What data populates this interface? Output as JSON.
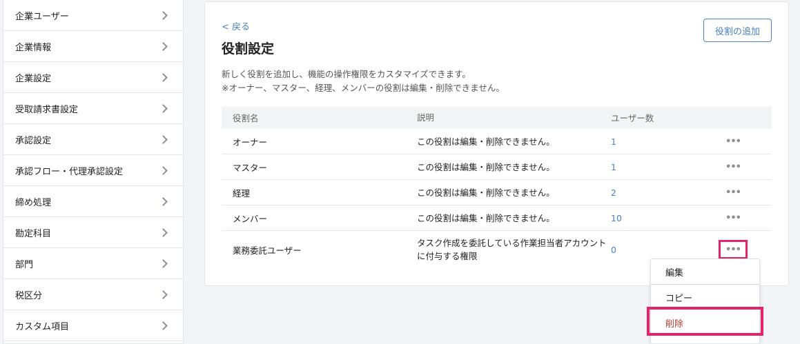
{
  "sidebar": {
    "items": [
      {
        "label": "企業ユーザー"
      },
      {
        "label": "企業情報"
      },
      {
        "label": "企業設定"
      },
      {
        "label": "受取請求書設定"
      },
      {
        "label": "承認設定"
      },
      {
        "label": "承認フロー・代理承認設定"
      },
      {
        "label": "締め処理"
      },
      {
        "label": "勘定科目"
      },
      {
        "label": "部門"
      },
      {
        "label": "税区分"
      },
      {
        "label": "カスタム項目"
      }
    ]
  },
  "main": {
    "back_label": "< 戻る",
    "title": "役割設定",
    "add_role_label": "役割の追加",
    "description_line1": "新しく役割を追加し、機能の操作権限をカスタマイズできます。",
    "description_line2": "※オーナー、マスター、経理、メンバーの役割は編集・削除できません。"
  },
  "table": {
    "headers": {
      "name": "役割名",
      "description": "説明",
      "users": "ユーザー数"
    },
    "rows": [
      {
        "name": "オーナー",
        "description": "この役割は編集・削除できません。",
        "users": "1",
        "menu": "•••"
      },
      {
        "name": "マスター",
        "description": "この役割は編集・削除できません。",
        "users": "1",
        "menu": "•••"
      },
      {
        "name": "経理",
        "description": "この役割は編集・削除できません。",
        "users": "2",
        "menu": "•••"
      },
      {
        "name": "メンバー",
        "description": "この役割は編集・削除できません。",
        "users": "10",
        "menu": "•••"
      },
      {
        "name": "業務委託ユーザー",
        "description": "タスク作成を委託している作業担当者アカウントに付与する権限",
        "users": "0",
        "menu": "•••"
      }
    ]
  },
  "dropdown": {
    "edit_label": "編集",
    "copy_label": "コピー",
    "delete_label": "削除"
  },
  "colors": {
    "accent": "#4a7fc1",
    "highlight": "#e8216b",
    "danger": "#c0392b"
  }
}
